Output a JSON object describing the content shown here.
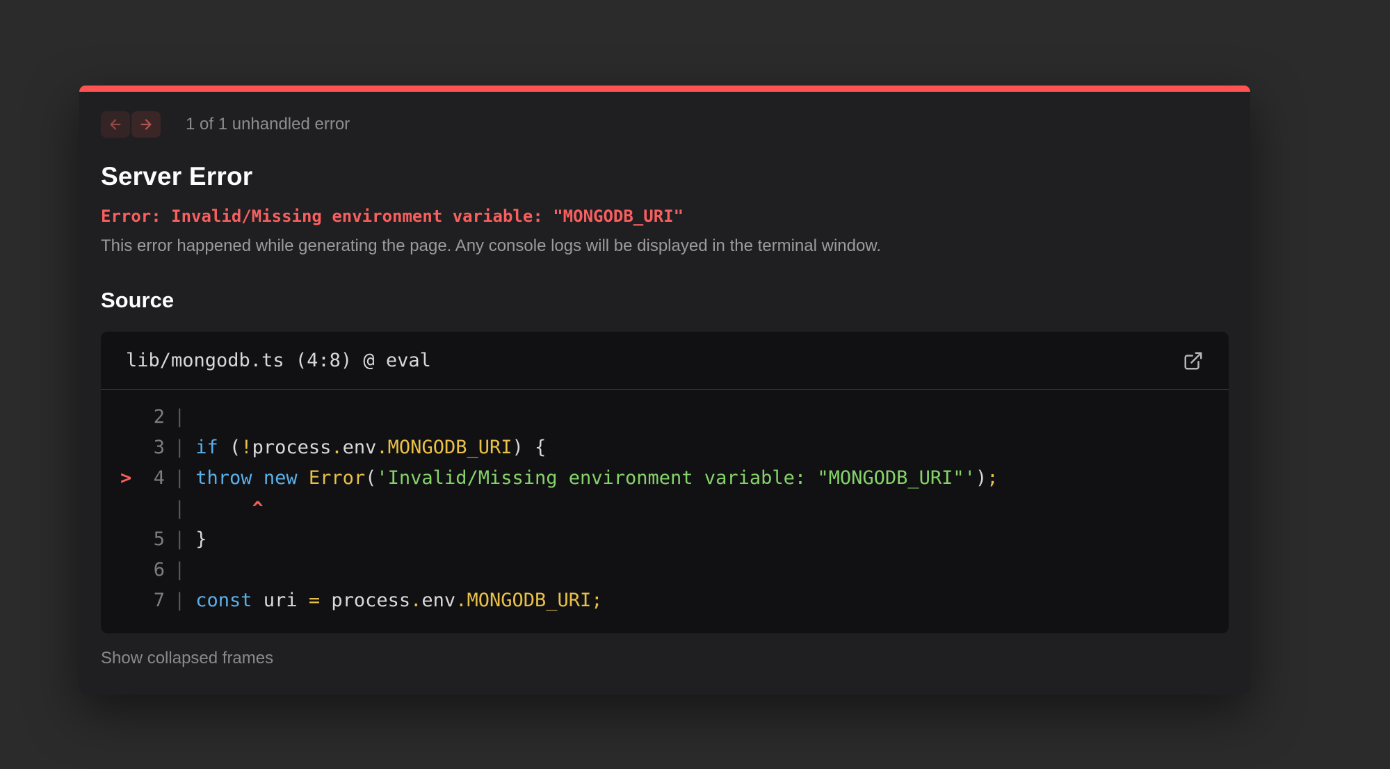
{
  "overlay": {
    "accent_color": "#ff5353",
    "nav": {
      "count_text": "1 of 1 unhandled error",
      "prev_icon": "arrow-left",
      "next_icon": "arrow-right"
    },
    "heading": "Server Error",
    "error_message": "Error: Invalid/Missing environment variable: \"MONGODB_URI\"",
    "description": "This error happened while generating the page. Any console logs will be displayed in the terminal window.",
    "source_heading": "Source",
    "source": {
      "file_label": "lib/mongodb.ts (4:8) @ eval",
      "open_icon": "external-link",
      "code_lines": [
        {
          "marker": "",
          "num": "2",
          "pipe": "|",
          "tokens": []
        },
        {
          "marker": "",
          "num": "3",
          "pipe": "|",
          "tokens": [
            {
              "t": "if",
              "c": "kw"
            },
            {
              "t": " (",
              "c": "pln"
            },
            {
              "t": "!",
              "c": "yel"
            },
            {
              "t": "process",
              "c": "pln"
            },
            {
              "t": ".",
              "c": "yel"
            },
            {
              "t": "env",
              "c": "pln"
            },
            {
              "t": ".",
              "c": "yel"
            },
            {
              "t": "MONGODB_URI",
              "c": "yel"
            },
            {
              "t": ") {",
              "c": "pln"
            }
          ]
        },
        {
          "marker": ">",
          "num": "4",
          "pipe": "|",
          "tokens": [
            {
              "t": "throw",
              "c": "kw"
            },
            {
              "t": " ",
              "c": "pln"
            },
            {
              "t": "new",
              "c": "kw"
            },
            {
              "t": " ",
              "c": "pln"
            },
            {
              "t": "Error",
              "c": "yel"
            },
            {
              "t": "(",
              "c": "pln"
            },
            {
              "t": "'Invalid/Missing environment variable: \"MONGODB_URI\"'",
              "c": "str"
            },
            {
              "t": ")",
              "c": "pln"
            },
            {
              "t": ";",
              "c": "yel"
            }
          ]
        },
        {
          "marker": "",
          "num": "",
          "pipe": "|",
          "tokens": [
            {
              "t": "     ",
              "c": "pln"
            },
            {
              "t": "^",
              "c": "caret"
            }
          ]
        },
        {
          "marker": "",
          "num": "5",
          "pipe": "|",
          "tokens": [
            {
              "t": "}",
              "c": "pln"
            }
          ]
        },
        {
          "marker": "",
          "num": "6",
          "pipe": "|",
          "tokens": []
        },
        {
          "marker": "",
          "num": "7",
          "pipe": "|",
          "tokens": [
            {
              "t": "const",
              "c": "kw"
            },
            {
              "t": " uri ",
              "c": "pln"
            },
            {
              "t": "=",
              "c": "yel"
            },
            {
              "t": " process",
              "c": "pln"
            },
            {
              "t": ".",
              "c": "yel"
            },
            {
              "t": "env",
              "c": "pln"
            },
            {
              "t": ".",
              "c": "yel"
            },
            {
              "t": "MONGODB_URI",
              "c": "yel"
            },
            {
              "t": ";",
              "c": "yel"
            }
          ]
        }
      ]
    },
    "footer": {
      "show_collapsed": "Show collapsed frames"
    }
  },
  "colors": {
    "page_bg": "#2b2b2c",
    "dialog_bg": "#1f1f21",
    "code_bg": "#111113",
    "accent_red": "#ff5353",
    "error_text": "#f85f5f",
    "keyword": "#5bb0ea",
    "constant_yellow": "#e9c048",
    "string_green": "#86d36a",
    "muted_text": "#9b9b9b"
  }
}
